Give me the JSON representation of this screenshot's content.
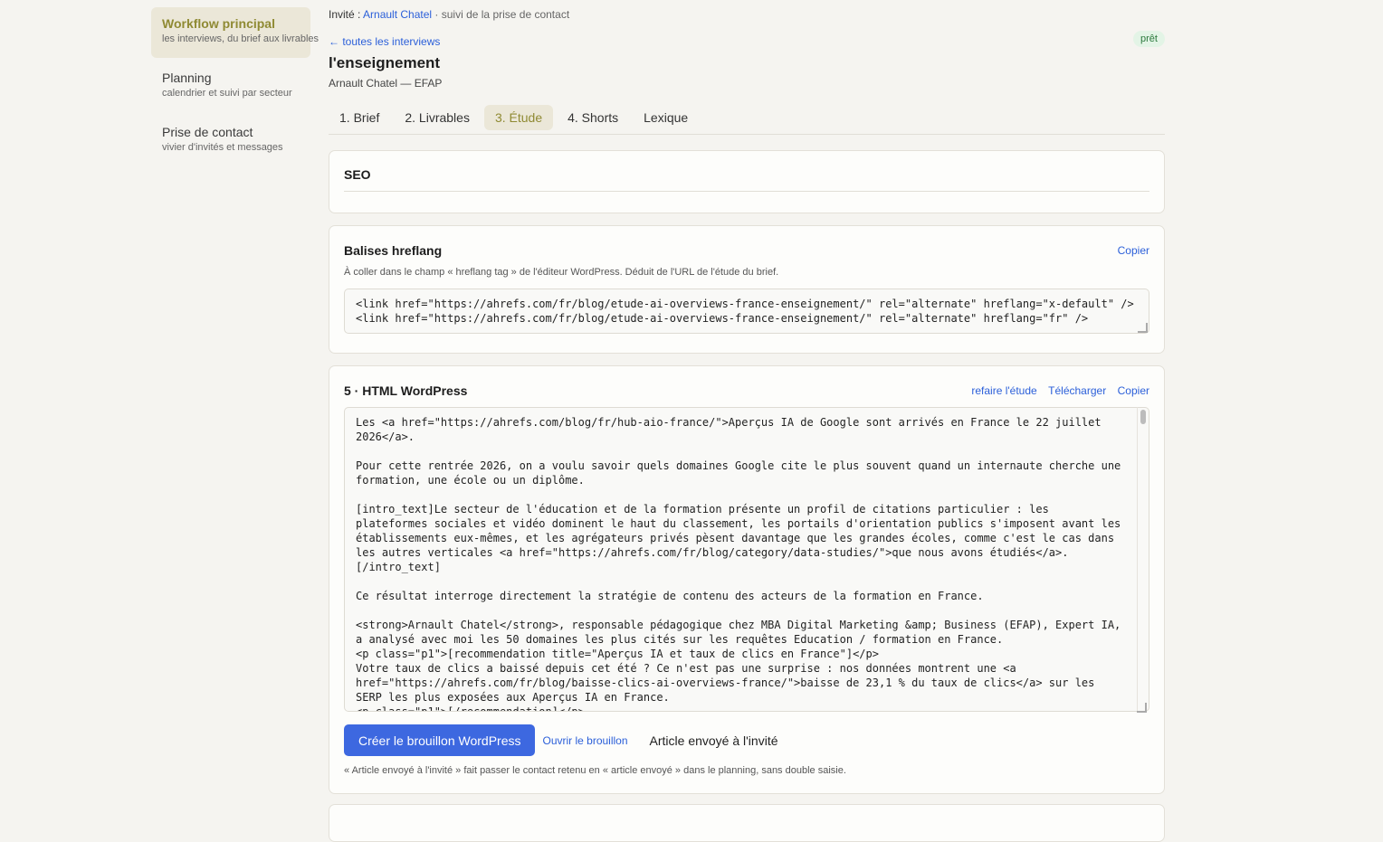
{
  "sidebar": {
    "items": [
      {
        "label": "Workflow principal",
        "sub": "les interviews, du brief aux livrables"
      },
      {
        "label": "Planning",
        "sub": "calendrier et suivi par secteur"
      },
      {
        "label": "Prise de contact",
        "sub": "vivier d'invités et messages"
      }
    ]
  },
  "header": {
    "crumb_label": "Invité :",
    "crumb_name": "Arnault Chatel",
    "crumb_suffix": " · suivi de la prise de contact",
    "back_link": "← toutes les interviews",
    "badge": "prêt",
    "title": "l'enseignement",
    "subtitle": "Arnault Chatel — EFAP"
  },
  "tabs": [
    "1. Brief",
    "2. Livrables",
    "3. Étude",
    "4. Shorts",
    "Lexique"
  ],
  "seo": {
    "title": "SEO"
  },
  "hreflang": {
    "title": "Balises hreflang",
    "copy": "Copier",
    "help": "À coller dans le champ « hreflang tag » de l'éditeur WordPress. Déduit de l'URL de l'étude du brief.",
    "code": "<link href=\"https://ahrefs.com/fr/blog/etude-ai-overviews-france-enseignement/\" rel=\"alternate\" hreflang=\"x-default\" />\n<link href=\"https://ahrefs.com/fr/blog/etude-ai-overviews-france-enseignement/\" rel=\"alternate\" hreflang=\"fr\" />"
  },
  "html_wp": {
    "title": "5 · HTML WordPress",
    "redo": "refaire l'étude",
    "download": "Télécharger",
    "copy": "Copier",
    "code": "Les <a href=\"https://ahrefs.com/blog/fr/hub-aio-france/\">Aperçus IA de Google sont arrivés en France le 22 juillet 2026</a>.\n\nPour cette rentrée 2026, on a voulu savoir quels domaines Google cite le plus souvent quand un internaute cherche une formation, une école ou un diplôme.\n\n[intro_text]Le secteur de l'éducation et de la formation présente un profil de citations particulier : les plateformes sociales et vidéo dominent le haut du classement, les portails d'orientation publics s'imposent avant les établissements eux-mêmes, et les agrégateurs privés pèsent davantage que les grandes écoles, comme c'est le cas dans les autres verticales <a href=\"https://ahrefs.com/fr/blog/category/data-studies/\">que nous avons étudiés</a>.\n[/intro_text]\n\nCe résultat interroge directement la stratégie de contenu des acteurs de la formation en France.\n\n<strong>Arnault Chatel</strong>, responsable pédagogique chez MBA Digital Marketing &amp; Business (EFAP), Expert IA, a analysé avec moi les 50 domaines les plus cités sur les requêtes Education / formation en France.\n<p class=\"p1\">[recommendation title=\"Aperçus IA et taux de clics en France\"]</p>\nVotre taux de clics a baissé depuis cet été ? Ce n'est pas une surprise : nos données montrent une <a href=\"https://ahrefs.com/fr/blog/baisse-clics-ai-overviews-france/\">baisse de 23,1 % du taux de clics</a> sur les SERP les plus exposées aux Aperçus IA en France.\n<p class=\"p1\">[/recommendation]</p>",
    "create_btn": "Créer le brouillon WordPress",
    "open_draft": "Ouvrir le brouillon",
    "sent": "Article envoyé à l'invité",
    "foot_help": "« Article envoyé à l'invité » fait passer le contact retenu en « article envoyé » dans le planning, sans double saisie."
  }
}
